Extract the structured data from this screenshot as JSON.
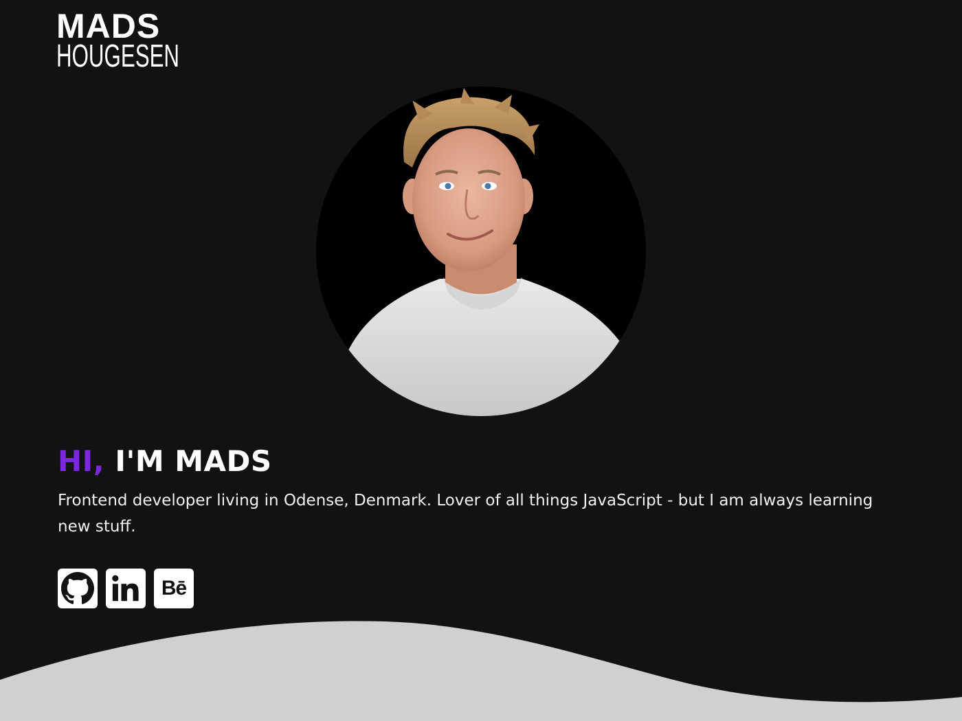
{
  "logo": {
    "line1": "MADS",
    "line2": "HOUGESEN"
  },
  "hero": {
    "greeting": "HI,",
    "name": "I'M MADS",
    "description": "Frontend developer living in Odense, Denmark. Lover of all things JavaScript - but I am always learning new stuff."
  },
  "socials": [
    {
      "name": "GitHub",
      "icon": "github-icon"
    },
    {
      "name": "LinkedIn",
      "icon": "linkedin-icon",
      "glyph": "in"
    },
    {
      "name": "Behance",
      "icon": "behance-icon",
      "glyph": "Bē"
    }
  ],
  "colors": {
    "background": "#121212",
    "accent": "#7a28e0",
    "wave": "#d0d0d0",
    "text": "#ffffff"
  }
}
